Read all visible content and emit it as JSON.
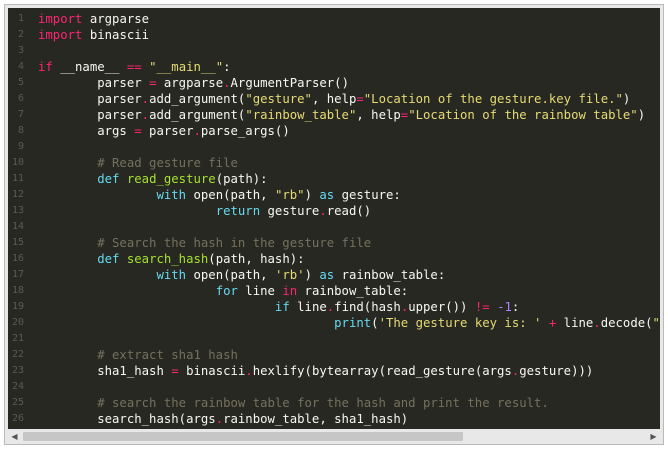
{
  "editor": {
    "lines": [
      {
        "n": "1",
        "tokens": [
          {
            "c": "kw",
            "t": "import"
          },
          {
            "c": "pl",
            "t": " argparse"
          }
        ]
      },
      {
        "n": "2",
        "tokens": [
          {
            "c": "kw",
            "t": "import"
          },
          {
            "c": "pl",
            "t": " binascii"
          }
        ]
      },
      {
        "n": "3",
        "tokens": []
      },
      {
        "n": "4",
        "tokens": [
          {
            "c": "kw",
            "t": "if"
          },
          {
            "c": "pl",
            "t": " __name__ "
          },
          {
            "c": "op",
            "t": "=="
          },
          {
            "c": "pl",
            "t": " "
          },
          {
            "c": "str",
            "t": "\"__main__\""
          },
          {
            "c": "pl",
            "t": ":"
          }
        ]
      },
      {
        "n": "5",
        "tokens": [
          {
            "c": "pl",
            "t": "        parser "
          },
          {
            "c": "op",
            "t": "="
          },
          {
            "c": "pl",
            "t": " argparse"
          },
          {
            "c": "op",
            "t": "."
          },
          {
            "c": "pl",
            "t": "ArgumentParser()"
          }
        ]
      },
      {
        "n": "6",
        "tokens": [
          {
            "c": "pl",
            "t": "        parser"
          },
          {
            "c": "op",
            "t": "."
          },
          {
            "c": "pl",
            "t": "add_argument("
          },
          {
            "c": "str",
            "t": "\"gesture\""
          },
          {
            "c": "pl",
            "t": ", help"
          },
          {
            "c": "op",
            "t": "="
          },
          {
            "c": "str",
            "t": "\"Location of the gesture.key file.\""
          },
          {
            "c": "pl",
            "t": ")"
          }
        ]
      },
      {
        "n": "7",
        "tokens": [
          {
            "c": "pl",
            "t": "        parser"
          },
          {
            "c": "op",
            "t": "."
          },
          {
            "c": "pl",
            "t": "add_argument("
          },
          {
            "c": "str",
            "t": "\"rainbow_table\""
          },
          {
            "c": "pl",
            "t": ", help"
          },
          {
            "c": "op",
            "t": "="
          },
          {
            "c": "str",
            "t": "\"Location of the rainbow table\""
          },
          {
            "c": "pl",
            "t": ")"
          }
        ]
      },
      {
        "n": "8",
        "tokens": [
          {
            "c": "pl",
            "t": "        args "
          },
          {
            "c": "op",
            "t": "="
          },
          {
            "c": "pl",
            "t": " parser"
          },
          {
            "c": "op",
            "t": "."
          },
          {
            "c": "pl",
            "t": "parse_args()"
          }
        ]
      },
      {
        "n": "9",
        "tokens": []
      },
      {
        "n": "10",
        "tokens": [
          {
            "c": "cm",
            "t": "        # Read gesture file"
          }
        ]
      },
      {
        "n": "11",
        "tokens": [
          {
            "c": "pl",
            "t": "        "
          },
          {
            "c": "kw2",
            "t": "def"
          },
          {
            "c": "pl",
            "t": " "
          },
          {
            "c": "fn",
            "t": "read_gesture"
          },
          {
            "c": "pl",
            "t": "(path):"
          }
        ]
      },
      {
        "n": "12",
        "tokens": [
          {
            "c": "pl",
            "t": "                "
          },
          {
            "c": "kw2",
            "t": "with"
          },
          {
            "c": "pl",
            "t": " open(path, "
          },
          {
            "c": "str",
            "t": "\"rb\""
          },
          {
            "c": "pl",
            "t": ") "
          },
          {
            "c": "kw2",
            "t": "as"
          },
          {
            "c": "pl",
            "t": " gesture:"
          }
        ]
      },
      {
        "n": "13",
        "tokens": [
          {
            "c": "pl",
            "t": "                        "
          },
          {
            "c": "kw2",
            "t": "return"
          },
          {
            "c": "pl",
            "t": " gesture"
          },
          {
            "c": "op",
            "t": "."
          },
          {
            "c": "pl",
            "t": "read()"
          }
        ]
      },
      {
        "n": "14",
        "tokens": []
      },
      {
        "n": "15",
        "tokens": [
          {
            "c": "cm",
            "t": "        # Search the hash in the gesture file"
          }
        ]
      },
      {
        "n": "16",
        "tokens": [
          {
            "c": "pl",
            "t": "        "
          },
          {
            "c": "kw2",
            "t": "def"
          },
          {
            "c": "pl",
            "t": " "
          },
          {
            "c": "fn",
            "t": "search_hash"
          },
          {
            "c": "pl",
            "t": "(path, hash):"
          }
        ]
      },
      {
        "n": "17",
        "tokens": [
          {
            "c": "pl",
            "t": "                "
          },
          {
            "c": "kw2",
            "t": "with"
          },
          {
            "c": "pl",
            "t": " open(path, "
          },
          {
            "c": "str",
            "t": "'rb'"
          },
          {
            "c": "pl",
            "t": ") "
          },
          {
            "c": "kw2",
            "t": "as"
          },
          {
            "c": "pl",
            "t": " rainbow_table:"
          }
        ]
      },
      {
        "n": "18",
        "tokens": [
          {
            "c": "pl",
            "t": "                        "
          },
          {
            "c": "kw2",
            "t": "for"
          },
          {
            "c": "pl",
            "t": " line "
          },
          {
            "c": "op",
            "t": "in"
          },
          {
            "c": "pl",
            "t": " rainbow_table:"
          }
        ]
      },
      {
        "n": "19",
        "tokens": [
          {
            "c": "pl",
            "t": "                                "
          },
          {
            "c": "kw2",
            "t": "if"
          },
          {
            "c": "pl",
            "t": " line"
          },
          {
            "c": "op",
            "t": "."
          },
          {
            "c": "pl",
            "t": "find(hash"
          },
          {
            "c": "op",
            "t": "."
          },
          {
            "c": "pl",
            "t": "upper()) "
          },
          {
            "c": "op",
            "t": "!="
          },
          {
            "c": "pl",
            "t": " "
          },
          {
            "c": "num",
            "t": "-1"
          },
          {
            "c": "pl",
            "t": ":"
          }
        ]
      },
      {
        "n": "20",
        "tokens": [
          {
            "c": "pl",
            "t": "                                        "
          },
          {
            "c": "kw2",
            "t": "print"
          },
          {
            "c": "pl",
            "t": "("
          },
          {
            "c": "str",
            "t": "'The gesture key is: '"
          },
          {
            "c": "pl",
            "t": " "
          },
          {
            "c": "op",
            "t": "+"
          },
          {
            "c": "pl",
            "t": " line"
          },
          {
            "c": "op",
            "t": "."
          },
          {
            "c": "pl",
            "t": "decode("
          },
          {
            "c": "str",
            "t": "\"utf-"
          }
        ]
      },
      {
        "n": "21",
        "tokens": []
      },
      {
        "n": "22",
        "tokens": [
          {
            "c": "cm",
            "t": "        # extract sha1 hash"
          }
        ]
      },
      {
        "n": "23",
        "tokens": [
          {
            "c": "pl",
            "t": "        sha1_hash "
          },
          {
            "c": "op",
            "t": "="
          },
          {
            "c": "pl",
            "t": " binascii"
          },
          {
            "c": "op",
            "t": "."
          },
          {
            "c": "pl",
            "t": "hexlify(bytearray(read_gesture(args"
          },
          {
            "c": "op",
            "t": "."
          },
          {
            "c": "pl",
            "t": "gesture)))"
          }
        ]
      },
      {
        "n": "24",
        "tokens": []
      },
      {
        "n": "25",
        "tokens": [
          {
            "c": "cm",
            "t": "        # search the rainbow table for the hash and print the result."
          }
        ]
      },
      {
        "n": "26",
        "tokens": [
          {
            "c": "pl",
            "t": "        search_hash(args"
          },
          {
            "c": "op",
            "t": "."
          },
          {
            "c": "pl",
            "t": "rainbow_table, sha1_hash)"
          }
        ]
      }
    ]
  },
  "scrollbar": {
    "left_arrow": "◀",
    "right_arrow": "▶",
    "position_fraction": 0.0
  }
}
